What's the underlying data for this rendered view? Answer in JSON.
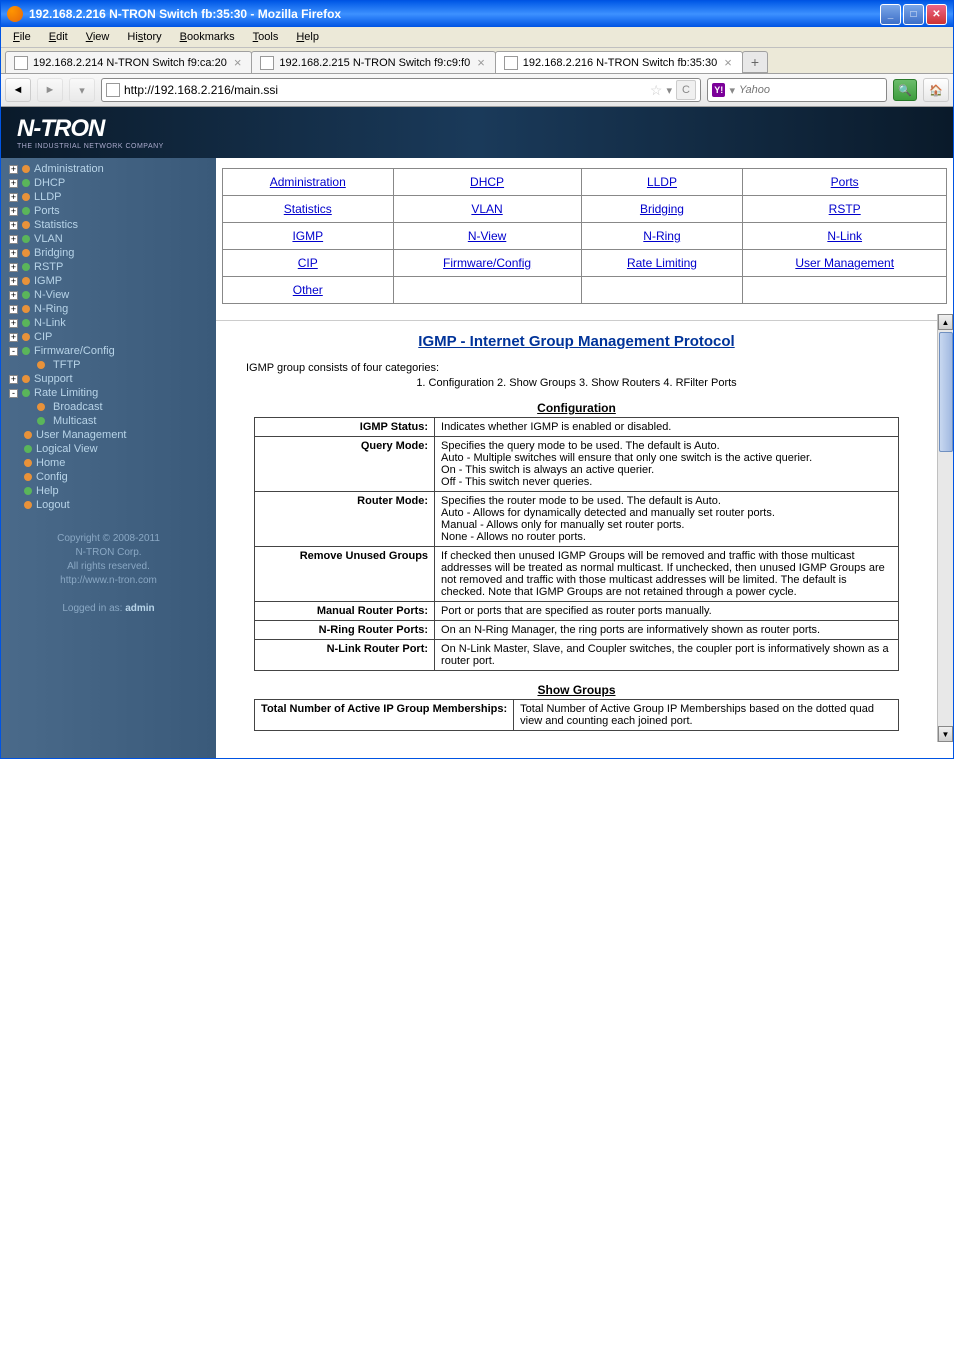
{
  "window": {
    "title": "192.168.2.216 N-TRON Switch fb:35:30 - Mozilla Firefox"
  },
  "menubar": [
    "File",
    "Edit",
    "View",
    "History",
    "Bookmarks",
    "Tools",
    "Help"
  ],
  "tabs": [
    {
      "label": "192.168.2.214 N-TRON Switch f9:ca:20",
      "active": false
    },
    {
      "label": "192.168.2.215 N-TRON Switch f9:c9:f0",
      "active": false
    },
    {
      "label": "192.168.2.216 N-TRON Switch fb:35:30",
      "active": true
    }
  ],
  "url": "http://192.168.2.216/main.ssi",
  "search_placeholder": "Yahoo",
  "logo": {
    "text": "N-TRON",
    "sub": "THE INDUSTRIAL NETWORK COMPANY"
  },
  "sidebar": {
    "items": [
      {
        "t": "+",
        "b": "orange",
        "label": "Administration"
      },
      {
        "t": "+",
        "b": "green",
        "label": "DHCP"
      },
      {
        "t": "+",
        "b": "orange",
        "label": "LLDP"
      },
      {
        "t": "+",
        "b": "green",
        "label": "Ports"
      },
      {
        "t": "+",
        "b": "orange",
        "label": "Statistics"
      },
      {
        "t": "+",
        "b": "green",
        "label": "VLAN"
      },
      {
        "t": "+",
        "b": "orange",
        "label": "Bridging"
      },
      {
        "t": "+",
        "b": "green",
        "label": "RSTP"
      },
      {
        "t": "+",
        "b": "orange",
        "label": "IGMP"
      },
      {
        "t": "+",
        "b": "green",
        "label": "N-View"
      },
      {
        "t": "+",
        "b": "orange",
        "label": "N-Ring"
      },
      {
        "t": "+",
        "b": "green",
        "label": "N-Link"
      },
      {
        "t": "+",
        "b": "orange",
        "label": "CIP"
      },
      {
        "t": "-",
        "b": "green",
        "label": "Firmware/Config"
      },
      {
        "t": "",
        "b": "orange",
        "label": "TFTP",
        "indent": true
      },
      {
        "t": "+",
        "b": "orange",
        "label": "Support"
      },
      {
        "t": "-",
        "b": "green",
        "label": "Rate Limiting"
      },
      {
        "t": "",
        "b": "orange",
        "label": "Broadcast",
        "indent": true
      },
      {
        "t": "",
        "b": "green",
        "label": "Multicast",
        "indent": true
      },
      {
        "t": "",
        "b": "orange",
        "label": "User Management"
      },
      {
        "t": "",
        "b": "green",
        "label": "Logical View"
      },
      {
        "t": "",
        "b": "orange",
        "label": "Home"
      },
      {
        "t": "",
        "b": "orange",
        "label": "Config"
      },
      {
        "t": "",
        "b": "green",
        "label": "Help"
      },
      {
        "t": "",
        "b": "orange",
        "label": "Logout"
      }
    ],
    "footer": {
      "copyright": "Copyright © 2008-2011",
      "corp": "N-TRON Corp.",
      "rights": "All rights reserved.",
      "url": "http://www.n-tron.com"
    },
    "logged": {
      "prefix": "Logged in as: ",
      "user": "admin"
    }
  },
  "navgrid": [
    [
      "Administration",
      "DHCP",
      "LLDP",
      "Ports"
    ],
    [
      "Statistics",
      "VLAN",
      "Bridging",
      "RSTP"
    ],
    [
      "IGMP",
      "N-View",
      "N-Ring",
      "N-Link"
    ],
    [
      "CIP",
      "Firmware/Config",
      "Rate Limiting",
      "User Management"
    ],
    [
      "Other",
      "",
      "",
      ""
    ]
  ],
  "page": {
    "title": "IGMP - Internet Group Management Protocol",
    "intro": "IGMP group consists of four categories:",
    "intro_sub": "1. Configuration  2. Show Groups  3. Show Routers  4. RFilter Ports",
    "sections": {
      "config": {
        "head": "Configuration",
        "rows": [
          {
            "k": "IGMP Status:",
            "v": "Indicates whether IGMP is enabled or disabled."
          },
          {
            "k": "Query Mode:",
            "v": "Specifies the query mode to be used. The default is Auto.\n   Auto - Multiple switches will ensure that only one switch is the active querier.\n   On - This switch is always an active querier.\n   Off - This switch never queries."
          },
          {
            "k": "Router Mode:",
            "v": "Specifies the router mode to be used. The default is Auto.\n   Auto - Allows for dynamically detected and manually set router ports.\n   Manual - Allows only for manually set router ports.\n   None - Allows no router ports."
          },
          {
            "k": "Remove Unused Groups",
            "v": "If checked then unused IGMP Groups will be removed and traffic with those multicast addresses will be treated as normal multicast. If unchecked, then unused IGMP Groups are not removed and traffic with those multicast addresses will be limited. The default is checked. Note that IGMP Groups are not retained through a power cycle."
          },
          {
            "k": "Manual Router Ports:",
            "v": "Port or ports that are specified as router ports manually."
          },
          {
            "k": "N-Ring Router Ports:",
            "v": "On an N-Ring Manager, the ring ports are informatively shown as router ports."
          },
          {
            "k": "N-Link Router Port:",
            "v": "On N-Link Master, Slave, and Coupler switches, the coupler port is informatively shown as a router port."
          }
        ]
      },
      "groups": {
        "head": "Show Groups",
        "rows": [
          {
            "k": "Total Number of Active IP Group Memberships:",
            "v": "Total Number of Active Group IP Memberships based on the dotted quad view and counting each joined port."
          }
        ]
      }
    }
  }
}
